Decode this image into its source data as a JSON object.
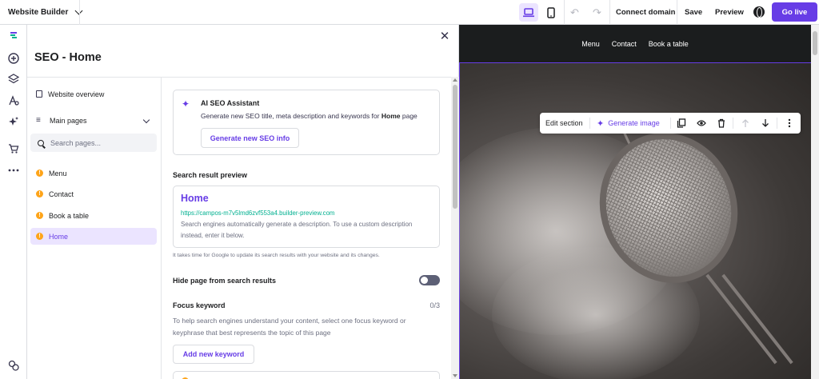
{
  "topbar": {
    "site_name": "Website Builder",
    "connect_domain": "Connect domain",
    "save": "Save",
    "preview": "Preview",
    "go_live": "Go live"
  },
  "panel": {
    "title": "SEO - Home",
    "website_overview": "Website overview",
    "main_pages": "Main pages",
    "search_placeholder": "Search pages...",
    "pages": [
      "Menu",
      "Contact",
      "Book a table",
      "Home"
    ],
    "active_page": "Home"
  },
  "seo": {
    "ai_title": "AI SEO Assistant",
    "ai_desc_prefix": "Generate new SEO title, meta description and keywords for",
    "ai_desc_page": "Home",
    "ai_desc_suffix": "page",
    "generate_button": "Generate new SEO info",
    "search_preview_label": "Search result preview",
    "preview_title": "Home",
    "preview_url": "https://campos-m7v5lmd6zvf553a4.builder-preview.com",
    "preview_desc": "Search engines automatically generate a description. To use a custom description instead, enter it below.",
    "update_note": "It takes time for Google to update its search results with your website and its changes.",
    "hide_page_label": "Hide page from search results",
    "hide_page_enabled": false,
    "focus_keyword_label": "Focus keyword",
    "keyword_count": "0/3",
    "keyword_desc": "To help search engines understand your content, select one focus keyword or keyphrase that best represents the topic of this page",
    "add_keyword_button": "Add new keyword"
  },
  "site": {
    "nav": [
      "Menu",
      "Contact",
      "Book a table"
    ]
  },
  "section_toolbar": {
    "edit_section": "Edit section",
    "generate_image": "Generate image"
  },
  "colors": {
    "accent": "#673de6",
    "accent_light": "#ebe4ff",
    "warning": "#fea419",
    "url_green": "#00b090"
  }
}
